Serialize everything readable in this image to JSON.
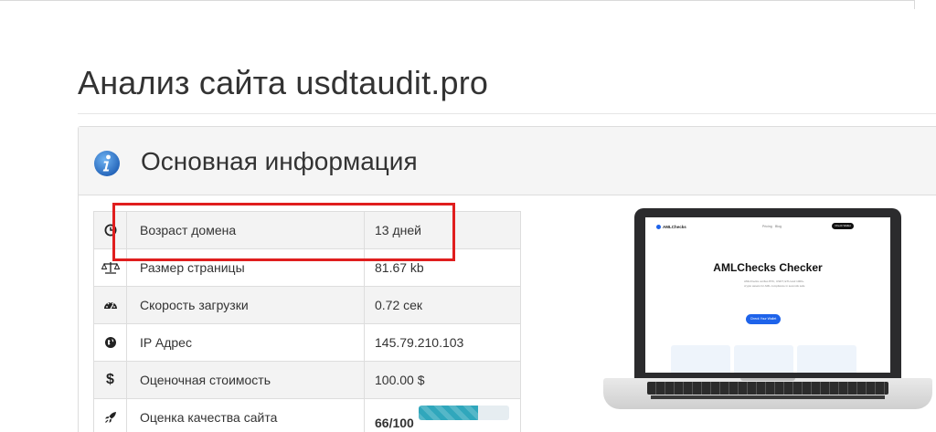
{
  "page": {
    "title": "Анализ сайта usdtaudit.pro"
  },
  "panel": {
    "title": "Основная информация",
    "icon": "info-icon"
  },
  "rows": [
    {
      "icon": "clock-icon",
      "label": "Возраст домена",
      "value": "13 дней"
    },
    {
      "icon": "scales-icon",
      "label": "Размер страницы",
      "value": "81.67 kb"
    },
    {
      "icon": "speedometer-icon",
      "label": "Скорость загрузки",
      "value": "0.72 сек"
    },
    {
      "icon": "globe-icon",
      "label": "IP Адрес",
      "value": "145.79.210.103"
    },
    {
      "icon": "dollar-icon",
      "label": "Оценочная стоимость",
      "value": "100.00 $"
    },
    {
      "icon": "rocket-icon",
      "label": "Оценка качества сайта",
      "value": "66/100"
    }
  ],
  "icons": {
    "dollar": "$"
  },
  "quality_score": {
    "value": 66,
    "max": 100
  },
  "screenshot": {
    "logo": "AMLChecks",
    "nav_links": [
      "Pricing",
      "Blog"
    ],
    "nav_button": "Check Wallet",
    "heading": "AMLChecks Checker",
    "subtitle": "AMLChecks verifies BTC, USDT, ETH and 1000+ crypto assets for AML compliance in seconds safe",
    "cta": "Check Your Wallet"
  },
  "colors": {
    "highlight": "#e01e1e",
    "progress": "#30a7bc",
    "info_icon": "#2f7fd3"
  }
}
